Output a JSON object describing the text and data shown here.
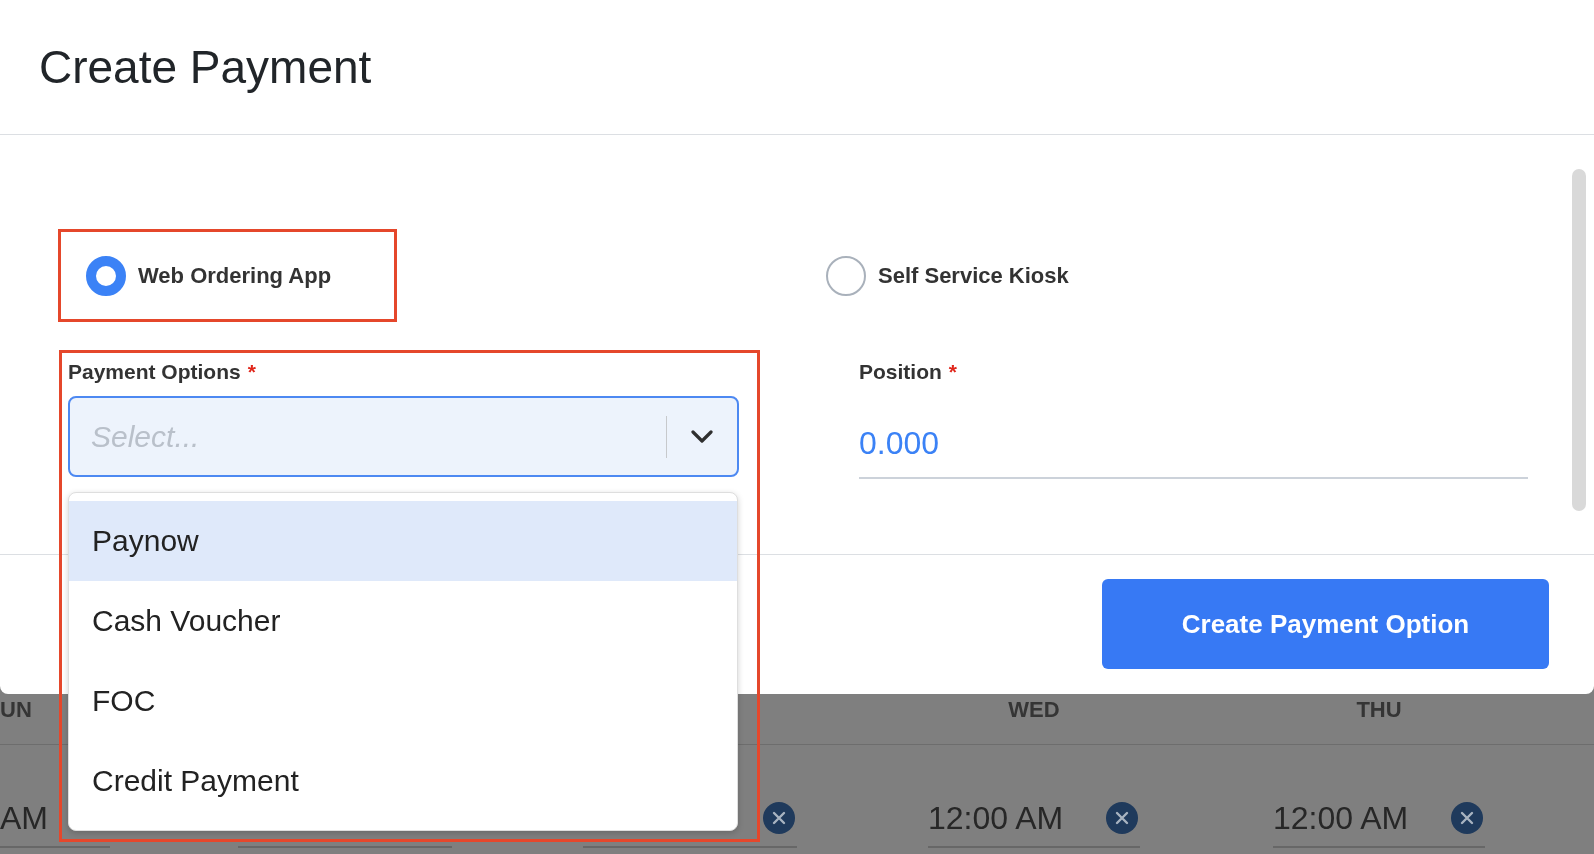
{
  "dialog": {
    "title": "Create Payment",
    "sales_channels": [
      {
        "label": "Web Ordering App",
        "selected": true,
        "annotated": true
      },
      {
        "label": "Self Service Kiosk",
        "selected": false,
        "annotated": false
      }
    ],
    "payment_options": {
      "label": "Payment Options",
      "required_mark": "*",
      "placeholder": "Select...",
      "focused": true,
      "annotated": true,
      "options": [
        {
          "label": "Paynow",
          "highlighted": true
        },
        {
          "label": "Cash Voucher",
          "highlighted": false
        },
        {
          "label": "FOC",
          "highlighted": false
        },
        {
          "label": "Credit Payment",
          "highlighted": false
        }
      ]
    },
    "position": {
      "label": "Position",
      "required_mark": "*",
      "value": "0.000"
    },
    "submit_button": "Create Payment Option"
  },
  "background_schedule": {
    "columns": [
      {
        "kind": "edge",
        "header": "UN",
        "value": "AM"
      },
      {
        "kind": "covered"
      },
      {
        "kind": "partial"
      },
      {
        "kind": "full",
        "header": "WED",
        "value": "12:00 AM"
      },
      {
        "kind": "full",
        "header": "THU",
        "value": "12:00 AM"
      }
    ]
  }
}
